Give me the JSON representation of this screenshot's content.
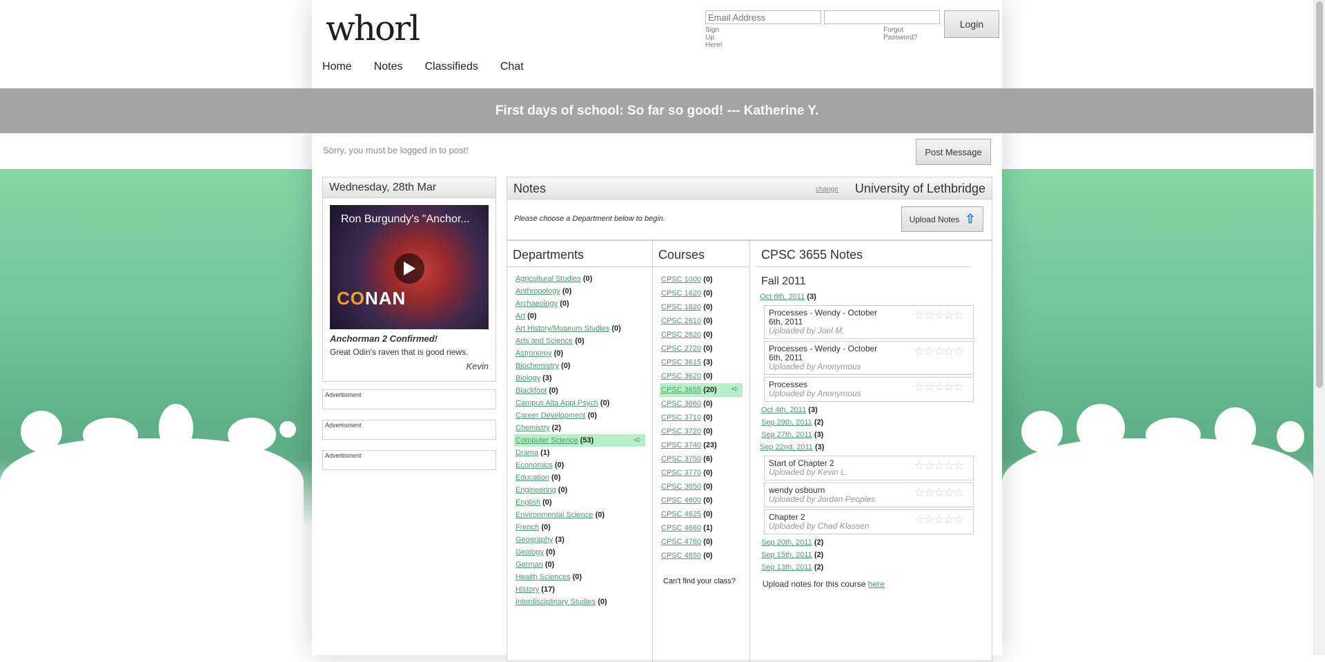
{
  "logo": {
    "text": "whorl"
  },
  "login": {
    "email_placeholder": "Email Address",
    "password_placeholder": "",
    "signup_label": "Sign Up Here!",
    "forgot_label": "Forgot Password?",
    "login_label": "Login"
  },
  "nav": [
    "Home",
    "Notes",
    "Classifieds",
    "Chat"
  ],
  "quote": "First days of school: So far so good! --- Katherine Y.",
  "post": {
    "message": "Sorry, you must be logged in to post!",
    "button": "Post Message"
  },
  "news": {
    "date": "Wednesday, 28th Mar",
    "video_title": "Ron Burgundy's \"Anchor...",
    "title": "Anchorman 2 Confirmed!",
    "body": "Great Odin's raven that is good news.",
    "author": "Kevin"
  },
  "ads": [
    "Advertisment",
    "Advertisment",
    "Advertisment"
  ],
  "notes": {
    "title": "Notes",
    "change": "change",
    "university": "University of Lethbridge",
    "instructions": "Please choose a Department below to begin.",
    "upload_label": "Upload Notes"
  },
  "departments": {
    "heading": "Departments",
    "items": [
      {
        "name": "Agricultural Studies",
        "count": "(0)"
      },
      {
        "name": "Anthropology",
        "count": "(0)"
      },
      {
        "name": "Archaeology",
        "count": "(0)"
      },
      {
        "name": "Art",
        "count": "(0)"
      },
      {
        "name": "Art History/Museum Studies",
        "count": "(0)"
      },
      {
        "name": "Arts and Science",
        "count": "(0)"
      },
      {
        "name": "Astronomy",
        "count": "(0)"
      },
      {
        "name": "Biochemistry",
        "count": "(0)"
      },
      {
        "name": "Biology",
        "count": "(3)"
      },
      {
        "name": "Blackfoot",
        "count": "(0)"
      },
      {
        "name": "Campus Alta Appl Psych",
        "count": "(0)"
      },
      {
        "name": "Career Development",
        "count": "(0)"
      },
      {
        "name": "Chemistry",
        "count": "(2)"
      },
      {
        "name": "Computer Science",
        "count": "(53)",
        "selected": true
      },
      {
        "name": "Drama",
        "count": "(1)"
      },
      {
        "name": "Economics",
        "count": "(0)"
      },
      {
        "name": "Education",
        "count": "(0)"
      },
      {
        "name": "Engineering",
        "count": "(0)"
      },
      {
        "name": "English",
        "count": "(0)"
      },
      {
        "name": "Environmental Science",
        "count": "(0)"
      },
      {
        "name": "French",
        "count": "(0)"
      },
      {
        "name": "Geography",
        "count": "(3)"
      },
      {
        "name": "Geology",
        "count": "(0)"
      },
      {
        "name": "German",
        "count": "(0)"
      },
      {
        "name": "Health Sciences",
        "count": "(0)"
      },
      {
        "name": "History",
        "count": "(17)"
      },
      {
        "name": "Interdisciplinary Studies",
        "count": "(0)"
      }
    ]
  },
  "courses": {
    "heading": "Courses",
    "items": [
      {
        "name": "CPSC 1000",
        "count": "(0)"
      },
      {
        "name": "CPSC 1620",
        "count": "(0)"
      },
      {
        "name": "CPSC 1820",
        "count": "(0)"
      },
      {
        "name": "CPSC 2610",
        "count": "(0)"
      },
      {
        "name": "CPSC 2620",
        "count": "(0)"
      },
      {
        "name": "CPSC 2720",
        "count": "(0)"
      },
      {
        "name": "CPSC 3615",
        "count": "(3)"
      },
      {
        "name": "CPSC 3620",
        "count": "(0)"
      },
      {
        "name": "CPSC 3655",
        "count": "(20)",
        "selected": true
      },
      {
        "name": "CPSC 3660",
        "count": "(0)"
      },
      {
        "name": "CPSC 3710",
        "count": "(0)"
      },
      {
        "name": "CPSC 3720",
        "count": "(0)"
      },
      {
        "name": "CPSC 3740",
        "count": "(23)"
      },
      {
        "name": "CPSC 3750",
        "count": "(6)"
      },
      {
        "name": "CPSC 3770",
        "count": "(0)"
      },
      {
        "name": "CPSC 3850",
        "count": "(0)"
      },
      {
        "name": "CPSC 4600",
        "count": "(0)"
      },
      {
        "name": "CPSC 4625",
        "count": "(0)"
      },
      {
        "name": "CPSC 4660",
        "count": "(1)"
      },
      {
        "name": "CPSC 4780",
        "count": "(0)"
      },
      {
        "name": "CPSC 4850",
        "count": "(0)"
      }
    ],
    "cant_find": "Can't find your class?"
  },
  "course_notes": {
    "heading": "CPSC 3655 Notes",
    "term": "Fall 2011",
    "sessions": [
      {
        "date": "Oct 6th, 2011",
        "count": "(3)",
        "notes": [
          {
            "name": "Processes - Wendy - October 6th, 2011",
            "uploader": "Uploaded by Joel M."
          },
          {
            "name": "Processes - Wendy - October 6th, 2011",
            "uploader": "Uploaded by Anonymous"
          },
          {
            "name": "Processes",
            "uploader": "Uploaded by Anonymous"
          }
        ]
      },
      {
        "date": "Oct 4th, 2011",
        "count": "(3)",
        "notes": []
      },
      {
        "date": "Sep 29th, 2011",
        "count": "(2)",
        "notes": []
      },
      {
        "date": "Sep 27th, 2011",
        "count": "(3)",
        "notes": []
      },
      {
        "date": "Sep 22nd, 2011",
        "count": "(3)",
        "notes": [
          {
            "name": "Start of Chapter 2",
            "uploader": "Uploaded by Kevin L."
          },
          {
            "name": "wendy osbourn",
            "uploader": "Uploaded by Jordan Peoples"
          },
          {
            "name": "Chapter 2",
            "uploader": "Uploaded by Chad Klassen"
          }
        ]
      },
      {
        "date": "Sep 20th, 2011",
        "count": "(2)",
        "notes": []
      },
      {
        "date": "Sep 15th, 2011",
        "count": "(2)",
        "notes": []
      },
      {
        "date": "Sep 13th, 2011",
        "count": "(2)",
        "notes": []
      }
    ],
    "upload_prefix": "Upload notes for this course ",
    "upload_link": "here"
  },
  "icons": {
    "play": "play-icon",
    "go": "arrow-right-icon",
    "upload": "upload-arrow-icon",
    "star": "star-icon"
  },
  "colors": {
    "accent_green": "#4f9a6e",
    "selected_bg": "#b5f0c5",
    "quote_bar": "#a4a4a4",
    "bg_green": "#6fc295"
  }
}
